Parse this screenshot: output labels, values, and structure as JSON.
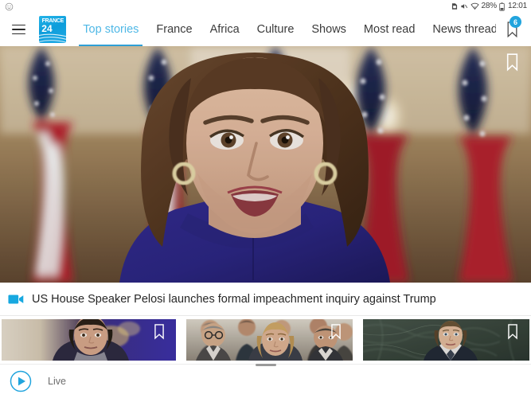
{
  "status_bar": {
    "left_icon": "smiley-notification-icon",
    "icons": [
      "sim-card-icon",
      "mute-icon",
      "wifi-icon",
      "battery-icon"
    ],
    "battery_percent": "28%",
    "clock": "12:01"
  },
  "nav": {
    "menu_icon": "hamburger-menu-icon",
    "brand": {
      "name_top": "FRANCE",
      "number": "24",
      "accent": "#19a5df"
    },
    "tabs": [
      {
        "label": "Top stories",
        "active": true
      },
      {
        "label": "France",
        "active": false
      },
      {
        "label": "Africa",
        "active": false
      },
      {
        "label": "Culture",
        "active": false
      },
      {
        "label": "Shows",
        "active": false
      },
      {
        "label": "Most read",
        "active": false
      },
      {
        "label": "News thread",
        "active": false
      }
    ],
    "bookmark": {
      "icon": "bookmark-icon",
      "badge_count": "6",
      "badge_color": "#21a4dd"
    },
    "active_tab_color": "#4fb8e6",
    "active_underline_color": "#2f9fd6"
  },
  "hero": {
    "alt": "Nancy Pelosi speaking in front of American flags",
    "bookmark_icon": "bookmark-icon",
    "headline": "US House Speaker Pelosi launches formal impeachment inquiry against Trump",
    "media_icon": "video-camera-icon",
    "media_icon_color": "#17a8e0"
  },
  "thumbnails": [
    {
      "alt": "Man in front of purple backdrop",
      "bookmark_icon": "bookmark-icon"
    },
    {
      "alt": "Crowd of officials in suits",
      "bookmark_icon": "bookmark-icon"
    },
    {
      "alt": "Emmanuel Macron at the UN podium",
      "bookmark_icon": "bookmark-icon"
    }
  ],
  "live": {
    "play_icon": "play-circle-icon",
    "label": "Live",
    "accent": "#21a4dd"
  }
}
